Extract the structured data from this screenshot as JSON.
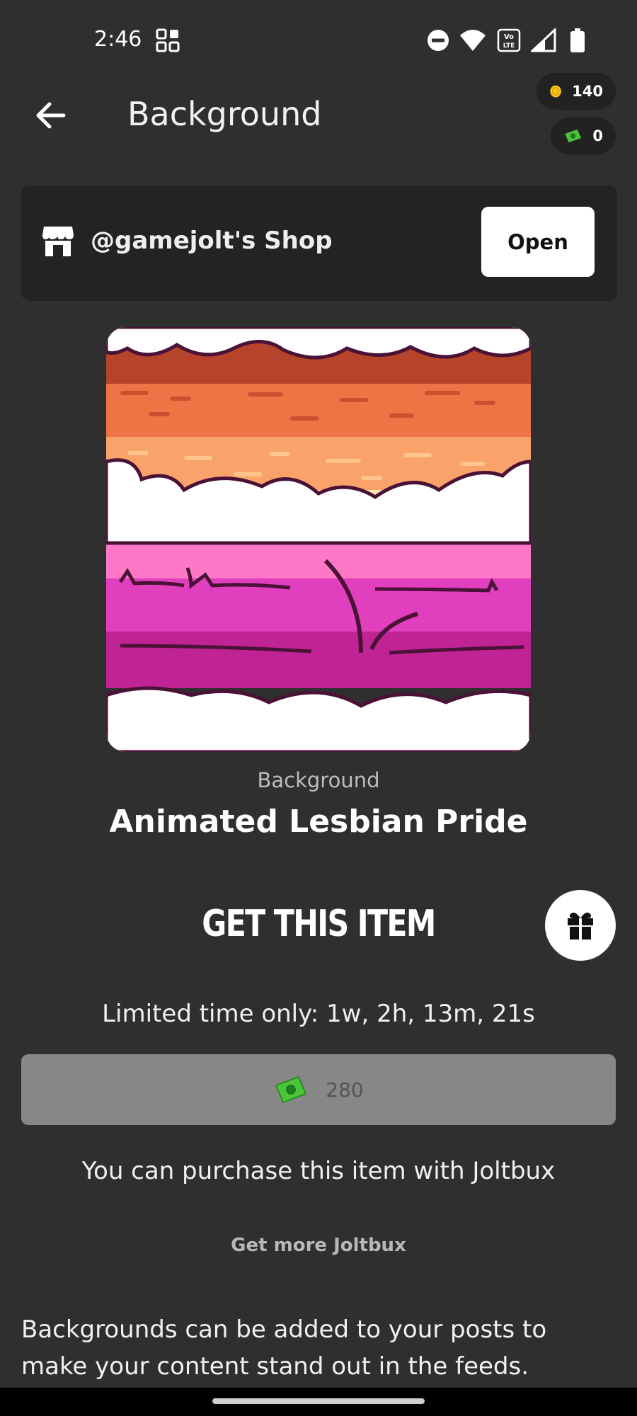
{
  "status_bar": {
    "time": "2:46",
    "icons": [
      "app-grid-icon",
      "dnd-icon",
      "wifi-icon",
      "volte-icon",
      "signal-icon",
      "battery-icon"
    ]
  },
  "header": {
    "title": "Background",
    "back_icon": "arrow-left-icon",
    "coins": "140",
    "joltbux": "0"
  },
  "shop": {
    "label": "@gamejolt's Shop",
    "open_label": "Open",
    "icon": "store-icon"
  },
  "item": {
    "category": "Background",
    "name": "Animated Lesbian Pride"
  },
  "purchase": {
    "heading": "GET THIS ITEM",
    "limited_text": "Limited time only: 1w, 2h, 13m, 21s",
    "price": "280",
    "note": "You can purchase this item with Joltbux",
    "get_more": "Get more Joltbux",
    "description": "Backgrounds can be added to your posts to make your content stand out in the feeds."
  },
  "colors": {
    "background": "#2f2f2f",
    "card": "#232323",
    "price_button": "#878787",
    "stripe_1": "#b5442a",
    "stripe_2": "#ee7445",
    "stripe_3": "#f9a36a",
    "stripe_4": "#ffffff",
    "stripe_5": "#ff78c8",
    "stripe_6": "#e23fbf",
    "stripe_7": "#c02494"
  }
}
